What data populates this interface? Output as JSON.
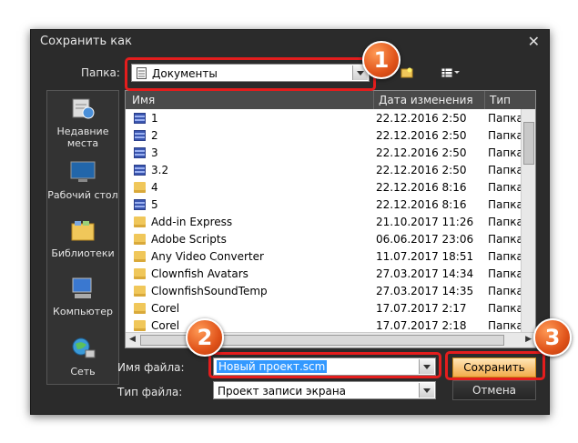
{
  "window": {
    "title": "Сохранить как"
  },
  "toolbar": {
    "folder_label": "Папка:",
    "folder_value": "Документы"
  },
  "places": [
    {
      "label": "Недавние места",
      "icon": "recent-places-icon"
    },
    {
      "label": "Рабочий стол",
      "icon": "desktop-icon"
    },
    {
      "label": "Библиотеки",
      "icon": "libraries-icon"
    },
    {
      "label": "Компьютер",
      "icon": "computer-icon"
    },
    {
      "label": "Сеть",
      "icon": "network-icon"
    }
  ],
  "columns": {
    "name": "Имя",
    "date": "Дата изменения",
    "type": "Тип"
  },
  "files": [
    {
      "name": "1",
      "date": "22.12.2016 2:50",
      "type": "Папка",
      "icon": "library-folder-icon"
    },
    {
      "name": "2",
      "date": "22.12.2016 2:50",
      "type": "Папка",
      "icon": "library-folder-icon"
    },
    {
      "name": "3",
      "date": "22.12.2016 2:50",
      "type": "Папка",
      "icon": "library-folder-icon"
    },
    {
      "name": "3.2",
      "date": "22.12.2016 2:50",
      "type": "Папка",
      "icon": "library-folder-icon"
    },
    {
      "name": "4",
      "date": "22.12.2016 8:16",
      "type": "Папка",
      "icon": "folder-icon"
    },
    {
      "name": "5",
      "date": "22.12.2016 8:16",
      "type": "Папка",
      "icon": "library-folder-icon"
    },
    {
      "name": "Add-in Express",
      "date": "21.10.2017 11:26",
      "type": "Папка",
      "icon": "folder-icon"
    },
    {
      "name": "Adobe Scripts",
      "date": "06.06.2017 23:06",
      "type": "Папка",
      "icon": "folder-icon"
    },
    {
      "name": "Any Video Converter",
      "date": "11.07.2017 18:51",
      "type": "Папка",
      "icon": "folder-icon"
    },
    {
      "name": "Clownfish Avatars",
      "date": "27.03.2017 14:34",
      "type": "Папка",
      "icon": "folder-icon"
    },
    {
      "name": "ClownfishSoundTemp",
      "date": "27.03.2017 14:35",
      "type": "Папка",
      "icon": "folder-icon"
    },
    {
      "name": "Corel",
      "date": "17.07.2017 2:17",
      "type": "Папка",
      "icon": "folder-icon"
    },
    {
      "name": "Corel",
      "date": "17.07.2017 2:18",
      "type": "Папка",
      "icon": "folder-icon"
    }
  ],
  "form": {
    "filename_label": "Имя файла:",
    "filename_value": "Новый проект.scm",
    "filetype_label": "Тип файла:",
    "filetype_value": "Проект записи экрана",
    "save_label": "Сохранить",
    "cancel_label": "Отмена"
  },
  "callouts": [
    "1",
    "2",
    "3"
  ],
  "colors": {
    "highlight": "#e41d1d",
    "callout": "#e0531a",
    "selection": "#3399ff"
  }
}
